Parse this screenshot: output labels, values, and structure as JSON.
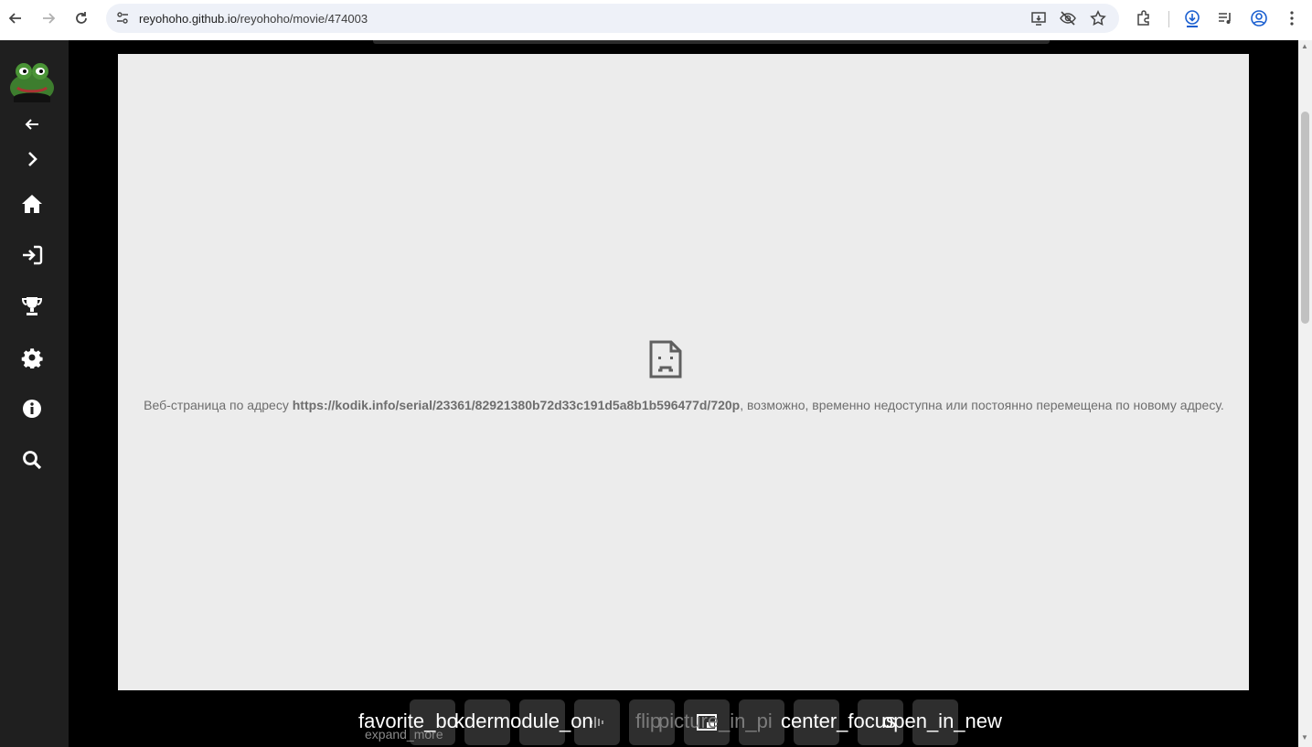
{
  "browser": {
    "url_host": "reyohoho.github.io",
    "url_path": "/reyohoho/movie/474003"
  },
  "sidebar": {
    "items": [
      {
        "icon": "arrow-left-icon"
      },
      {
        "icon": "chevron-right-icon"
      },
      {
        "icon": "home-icon"
      },
      {
        "icon": "login-icon"
      },
      {
        "icon": "trophy-icon"
      },
      {
        "icon": "gear-icon"
      },
      {
        "icon": "info-icon"
      },
      {
        "icon": "search-icon"
      }
    ]
  },
  "player": {
    "error_prefix": "Веб-страница по адресу ",
    "error_url": "https://kodik.info/serial/23361/82921380b72d33c191d5a8b1b596477d/720p",
    "error_suffix": ", возможно, временно недоступна или постоянно перемещена по новому адресу."
  },
  "controls": {
    "overlay_1": "favorite_bo",
    "overlay_2": "kdermodule_on",
    "overlay_3": "flip",
    "overlay_4": "picture_in_pi",
    "overlay_5": "center_focus",
    "overlay_6": "open_in_new",
    "expand_label": "expand_more"
  },
  "colors": {
    "sidebar_bg": "#1f1f1f",
    "player_bg": "#ececec",
    "page_bg": "#000000"
  }
}
